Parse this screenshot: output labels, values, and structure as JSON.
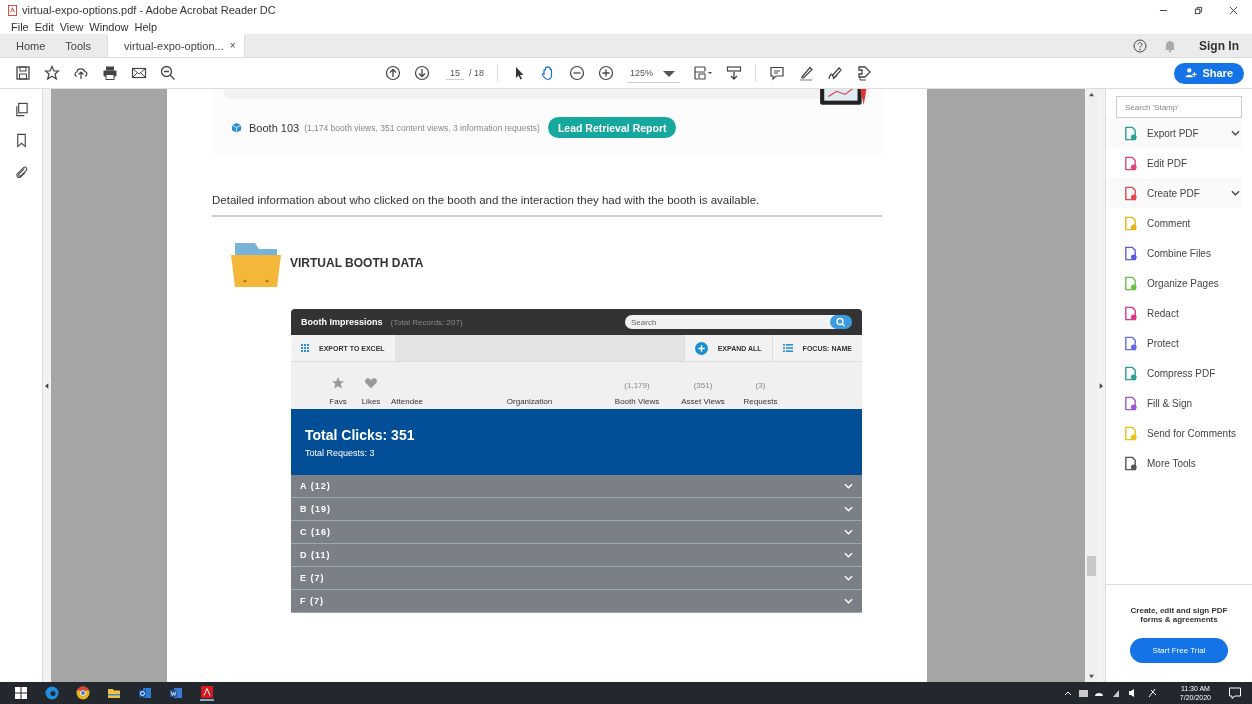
{
  "window": {
    "title": "virtual-expo-options.pdf - Adobe Acrobat Reader DC"
  },
  "menu": [
    "File",
    "Edit",
    "View",
    "Window",
    "Help"
  ],
  "tabs": [
    {
      "label": "Home",
      "selected": false
    },
    {
      "label": "Tools",
      "selected": false
    },
    {
      "label": "virtual-expo-option...",
      "selected": true,
      "close": "×"
    }
  ],
  "account": {
    "sign_in": "Sign In"
  },
  "toolbar": {
    "page": "15",
    "total": "/ 18",
    "zoom": "125%",
    "share": "Share"
  },
  "document": {
    "booth": {
      "name": "Booth 103",
      "stats": "(1,174 booth views, 351 content views, 3 information requests)",
      "button": "Lead Retrieval Report"
    },
    "paragraph": "Detailed information about who clicked on the booth and the interaction they had with the booth is available.",
    "section_title": "VIRTUAL BOOTH DATA",
    "widget": {
      "title": "Booth Impressions",
      "records": "(Total Records: 207)",
      "search_placeholder": "Search",
      "export": "EXPORT TO EXCEL",
      "expand": "EXPAND ALL",
      "focus": "FOCUS: NAME",
      "columns": [
        {
          "kind": "star",
          "label": "Favs"
        },
        {
          "kind": "heart",
          "label": "Likes"
        },
        {
          "kind": "text",
          "label": "Attendee"
        },
        {
          "kind": "text",
          "label": "Organization"
        },
        {
          "kind": "count",
          "label": "Booth Views",
          "count": "(1,179)"
        },
        {
          "kind": "count",
          "label": "Asset Views",
          "count": "(351)"
        },
        {
          "kind": "count",
          "label": "Requests",
          "count": "(3)"
        }
      ],
      "total_clicks": "Total Clicks: 351",
      "total_requests": "Total Requests: 3",
      "groups": [
        "A (12)",
        "B (19)",
        "C (16)",
        "D (11)",
        "E (7)",
        "F (7)"
      ]
    }
  },
  "tools_pane": {
    "search_placeholder": "Search 'Stamp'",
    "items": [
      {
        "label": "Export PDF",
        "color": "#2aa08f",
        "expandable": true
      },
      {
        "label": "Edit PDF",
        "color": "#e0467c",
        "expandable": false
      },
      {
        "label": "Create PDF",
        "color": "#e5484d",
        "expandable": true
      },
      {
        "label": "Comment",
        "color": "#e7b416",
        "expandable": false
      },
      {
        "label": "Combine Files",
        "color": "#5b5be0",
        "expandable": false
      },
      {
        "label": "Organize Pages",
        "color": "#6cc04a",
        "expandable": false
      },
      {
        "label": "Redact",
        "color": "#e0358a",
        "expandable": false
      },
      {
        "label": "Protect",
        "color": "#6a6ae0",
        "expandable": false
      },
      {
        "label": "Compress PDF",
        "color": "#2aa08f",
        "expandable": false
      },
      {
        "label": "Fill & Sign",
        "color": "#9b59d6",
        "expandable": false
      },
      {
        "label": "Send for Comments",
        "color": "#e7c416",
        "expandable": false
      },
      {
        "label": "More Tools",
        "color": "#555555",
        "expandable": false
      }
    ],
    "promo": "Create, edit and sign PDF forms & agreements",
    "trial": "Start Free Trial"
  },
  "taskbar": {
    "time": "11:30 AM",
    "date": "7/20/2020"
  }
}
